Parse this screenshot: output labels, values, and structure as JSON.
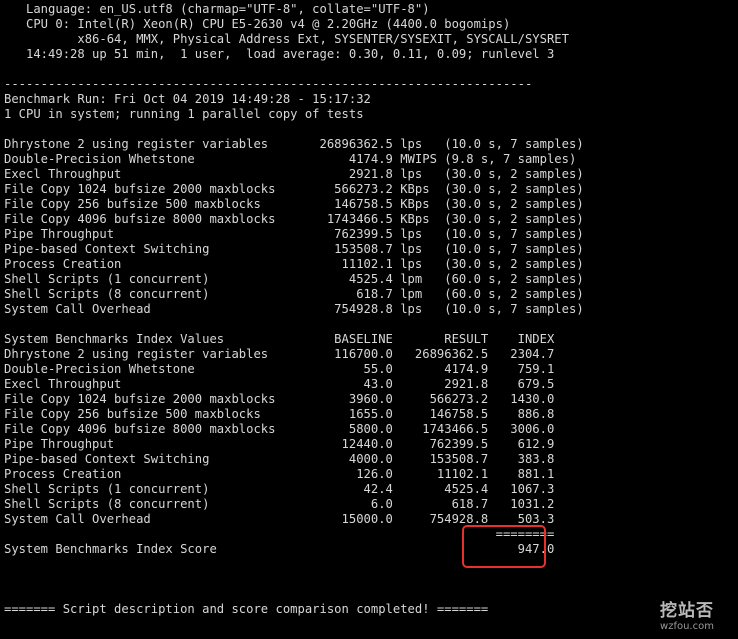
{
  "terminal": {
    "lines": [
      "   Language: en_US.utf8 (charmap=\"UTF-8\", collate=\"UTF-8\")",
      "   CPU 0: Intel(R) Xeon(R) CPU E5-2630 v4 @ 2.20GHz (4400.0 bogomips)",
      "          x86-64, MMX, Physical Address Ext, SYSENTER/SYSEXIT, SYSCALL/SYSRET",
      "   14:49:28 up 51 min,  1 user,  load average: 0.30, 0.11, 0.09; runlevel 3",
      "",
      "------------------------------------------------------------------------",
      "Benchmark Run: Fri Oct 04 2019 14:49:28 - 15:17:32",
      "1 CPU in system; running 1 parallel copy of tests",
      "",
      "Dhrystone 2 using register variables       26896362.5 lps   (10.0 s, 7 samples)",
      "Double-Precision Whetstone                     4174.9 MWIPS (9.8 s, 7 samples)",
      "Execl Throughput                               2921.8 lps   (30.0 s, 2 samples)",
      "File Copy 1024 bufsize 2000 maxblocks        566273.2 KBps  (30.0 s, 2 samples)",
      "File Copy 256 bufsize 500 maxblocks          146758.5 KBps  (30.0 s, 2 samples)",
      "File Copy 4096 bufsize 8000 maxblocks       1743466.5 KBps  (30.0 s, 2 samples)",
      "Pipe Throughput                              762399.5 lps   (10.0 s, 7 samples)",
      "Pipe-based Context Switching                 153508.7 lps   (10.0 s, 7 samples)",
      "Process Creation                              11102.1 lps   (30.0 s, 2 samples)",
      "Shell Scripts (1 concurrent)                   4525.4 lpm   (60.0 s, 2 samples)",
      "Shell Scripts (8 concurrent)                    618.7 lpm   (60.0 s, 2 samples)",
      "System Call Overhead                         754928.8 lps   (10.0 s, 7 samples)",
      "",
      "System Benchmarks Index Values               BASELINE       RESULT    INDEX",
      "Dhrystone 2 using register variables         116700.0   26896362.5   2304.7",
      "Double-Precision Whetstone                       55.0       4174.9    759.1",
      "Execl Throughput                                 43.0       2921.8    679.5",
      "File Copy 1024 bufsize 2000 maxblocks          3960.0     566273.2   1430.0",
      "File Copy 256 bufsize 500 maxblocks            1655.0     146758.5    886.8",
      "File Copy 4096 bufsize 8000 maxblocks          5800.0    1743466.5   3006.0",
      "Pipe Throughput                               12440.0     762399.5    612.9",
      "Pipe-based Context Switching                   4000.0     153508.7    383.8",
      "Process Creation                                126.0      11102.1    881.1",
      "Shell Scripts (1 concurrent)                     42.4       4525.4   1067.3",
      "Shell Scripts (8 concurrent)                      6.0        618.7   1031.2",
      "System Call Overhead                          15000.0     754928.8    503.3",
      "                                                                   ========",
      "System Benchmarks Index Score                                         947.0",
      "",
      "",
      "",
      "======= Script description and score comparison completed! ======="
    ]
  },
  "watermark": {
    "logo": "挖站否",
    "url": "wzfou.com"
  }
}
